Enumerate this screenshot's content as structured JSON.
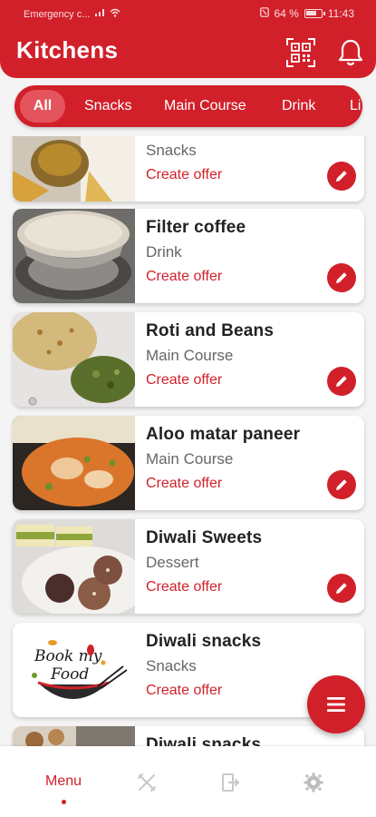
{
  "status_bar": {
    "carrier": "Emergency c...",
    "battery": "64 %",
    "time": "11:43"
  },
  "header": {
    "title": "Kitchens",
    "qr_icon": "qr-code-icon",
    "bell_icon": "bell-icon"
  },
  "categories": [
    "All",
    "Snacks",
    "Main Course",
    "Drink",
    "Li"
  ],
  "items": [
    {
      "name": "",
      "category": "Snacks",
      "action": "Create offer"
    },
    {
      "name": "Filter coffee",
      "category": "Drink",
      "action": "Create offer"
    },
    {
      "name": "Roti and Beans",
      "category": "Main Course",
      "action": "Create offer"
    },
    {
      "name": "Aloo matar paneer",
      "category": "Main Course",
      "action": "Create offer"
    },
    {
      "name": "Diwali Sweets",
      "category": "Dessert",
      "action": "Create offer"
    },
    {
      "name": "Diwali snacks",
      "category": "Snacks",
      "action": "Create offer"
    },
    {
      "name": "Diwali snacks",
      "category": "",
      "action": ""
    }
  ],
  "logo": {
    "text_line1": "Book my",
    "text_line2": "Food"
  },
  "fab_icon": "menu-icon",
  "bottom_nav": {
    "menu_label": "Menu",
    "icons": [
      "menu-icon",
      "utensils-icon",
      "exit-icon",
      "gear-icon"
    ]
  },
  "colors": {
    "primary": "#d1202a",
    "background": "#f5f4f4"
  }
}
